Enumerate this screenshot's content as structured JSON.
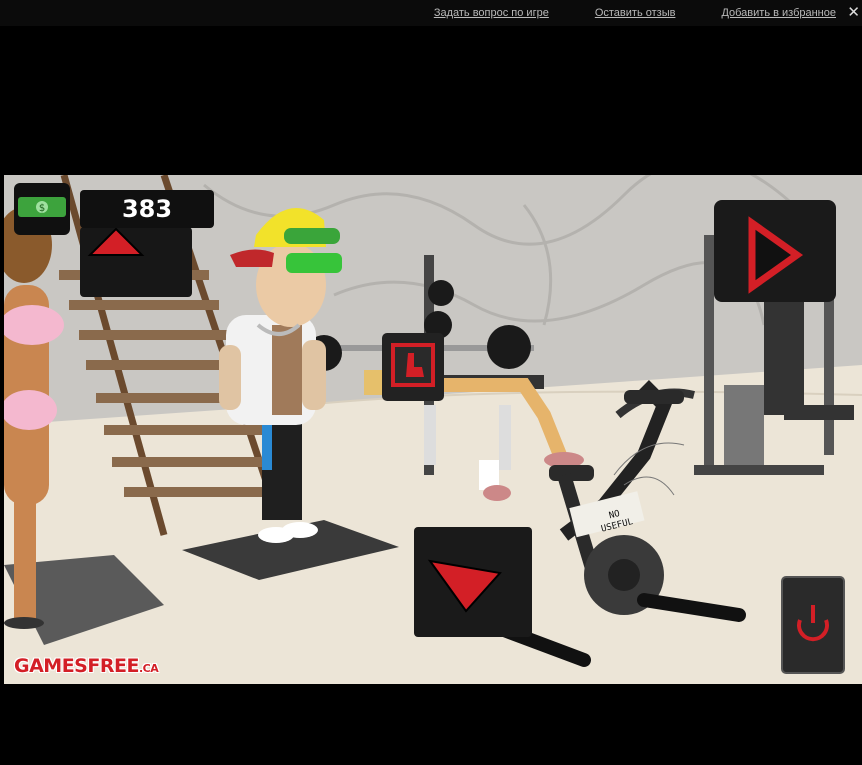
{
  "topbar": {
    "links": [
      "Задать вопрос по игре",
      "Оставить отзыв",
      "Добавить в избранное"
    ],
    "close_label": "✕"
  },
  "hud": {
    "money": "383",
    "money_icon": "dollar-bill-stack-icon"
  },
  "scene": {
    "bike_sign": "NO USEFUL"
  },
  "controls": {
    "next_icon": "play-arrow-icon",
    "back_icon": "red-arrow-left-icon",
    "up_icon": "red-arrow-up-icon",
    "bench_icon": "hand-pointer-icon",
    "power_icon": "power-icon"
  },
  "branding": {
    "logo_main": "GAMESFREE",
    "logo_suffix": ".CA"
  },
  "colors": {
    "accent_red": "#d31f26",
    "floor": "#e9e2d4",
    "wall": "#c9c7c3"
  }
}
